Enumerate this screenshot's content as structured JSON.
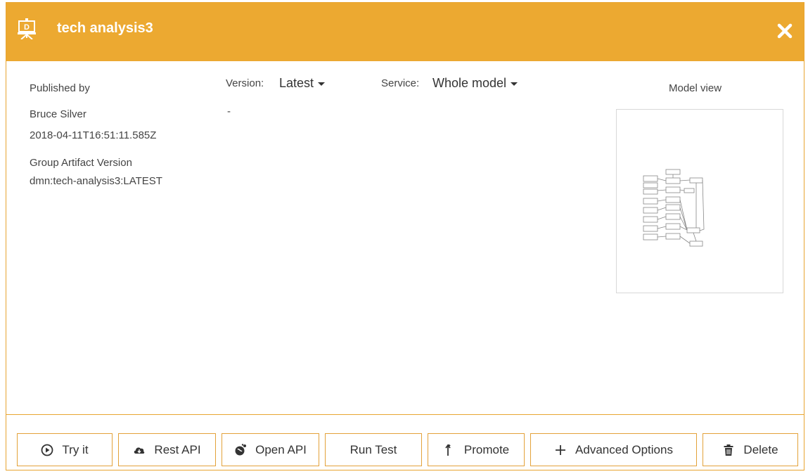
{
  "header": {
    "title": "tech analysis3",
    "accent_color": "#eca931",
    "app_icon": "dmn-presentation-icon",
    "close_icon": "close-icon"
  },
  "info": {
    "published_by_label": "Published by",
    "publisher": "Bruce Silver",
    "timestamp": "2018-04-11T16:51:11.585Z",
    "gav_label": "Group Artifact Version",
    "gav_value": "dmn:tech-analysis3:LATEST"
  },
  "version": {
    "label": "Version:",
    "selected": "Latest",
    "value": "-"
  },
  "service": {
    "label": "Service:",
    "selected": "Whole model"
  },
  "model_view": {
    "label": "Model view"
  },
  "buttons": {
    "try_it": "Try it",
    "rest_api": "Rest API",
    "open_api": "Open API",
    "run_test": "Run Test",
    "promote": "Promote",
    "advanced_options": "Advanced Options",
    "delete": "Delete"
  }
}
